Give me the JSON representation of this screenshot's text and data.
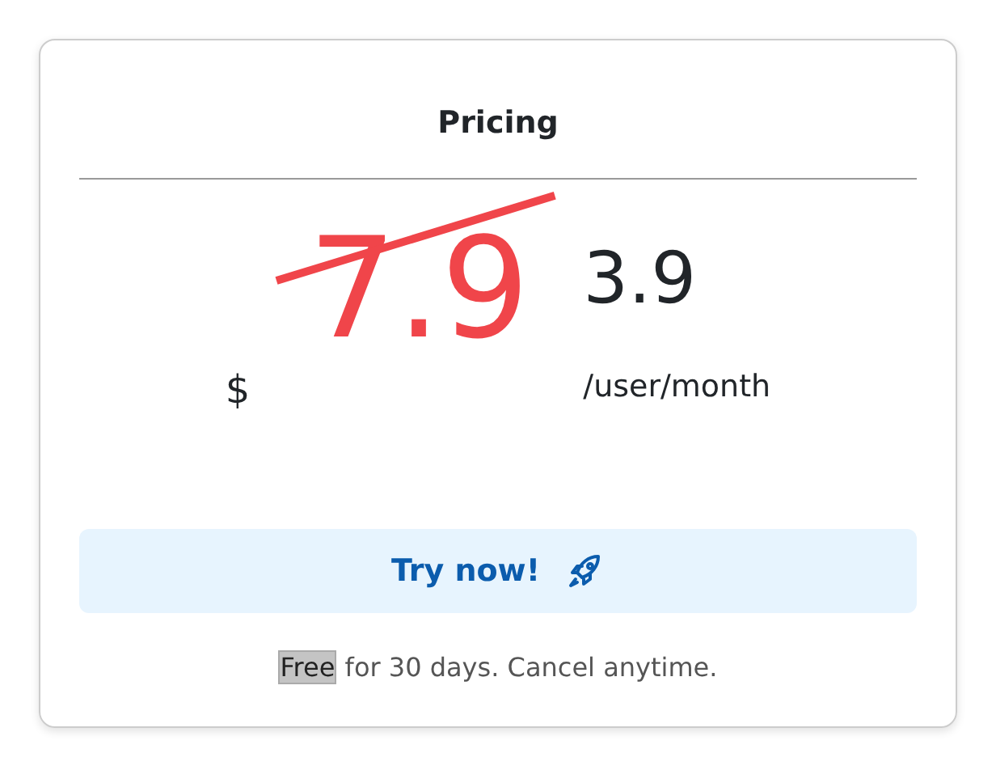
{
  "card": {
    "title": "Pricing",
    "price": {
      "currency": "$",
      "old_price": "7.9",
      "old_struck": true,
      "new_price": "3.9",
      "period": "/user/month"
    },
    "button": {
      "label": "Try now!"
    },
    "note": {
      "highlight": "Free",
      "text": "for 30 days. Cancel anytime."
    }
  }
}
